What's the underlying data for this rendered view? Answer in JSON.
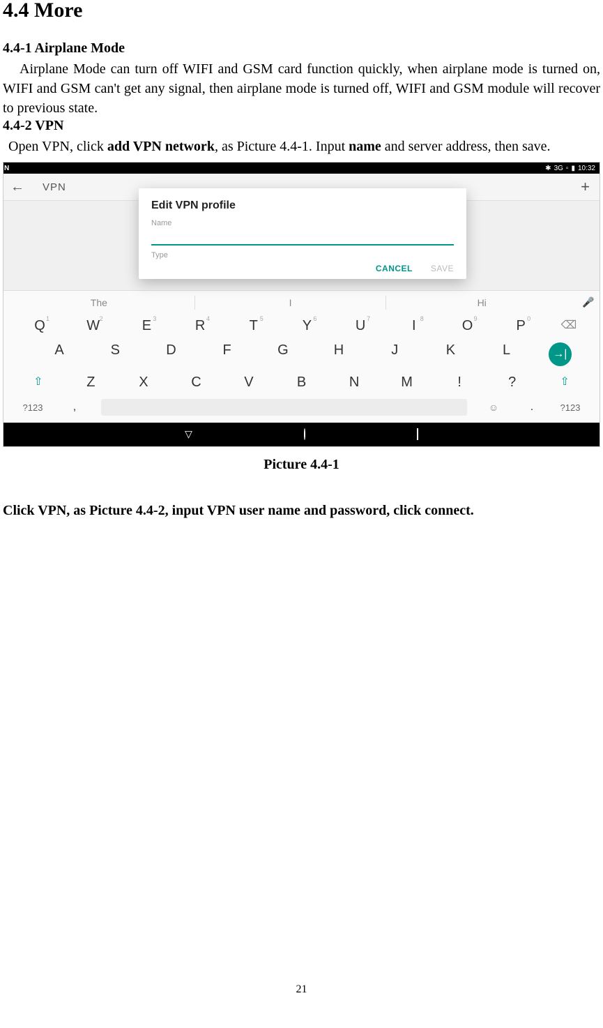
{
  "section": {
    "number_title": "4.4   More"
  },
  "sub1": {
    "title": "4.4-1 Airplane Mode",
    "body": "Airplane Mode can turn off WIFI and GSM card function quickly, when airplane mode is turned on, WIFI and GSM can't get any signal, then airplane mode is turned off, WIFI and GSM module will recover to previous state."
  },
  "sub2": {
    "title": "4.4-2 VPN",
    "body_pre": "Open VPN, click ",
    "bold1": "add VPN network",
    "body_mid": ", as Picture 4.4-1. Input ",
    "bold2": "name",
    "body_post": " and server address, then save."
  },
  "caption1": "Picture 4.4-1",
  "line2": "Click VPN, as Picture 4.4-2, input VPN user name and password, click connect.",
  "page_number": "21",
  "screenshot": {
    "status": {
      "bt": "✱",
      "net": "3G",
      "sig": "▫",
      "batt": "▮",
      "time": "10:32"
    },
    "appbar": {
      "back": "←",
      "title": "VPN",
      "add": "+"
    },
    "dialog": {
      "title": "Edit VPN profile",
      "name_label": "Name",
      "type_label": "Type",
      "cancel": "CANCEL",
      "save": "SAVE"
    },
    "suggestions": {
      "s1": "The",
      "s2": "I",
      "s3": "Hi"
    },
    "keyboard": {
      "row1": [
        {
          "k": "Q",
          "n": "1"
        },
        {
          "k": "W",
          "n": "2"
        },
        {
          "k": "E",
          "n": "3"
        },
        {
          "k": "R",
          "n": "4"
        },
        {
          "k": "T",
          "n": "5"
        },
        {
          "k": "Y",
          "n": "6"
        },
        {
          "k": "U",
          "n": "7"
        },
        {
          "k": "I",
          "n": "8"
        },
        {
          "k": "O",
          "n": "9"
        },
        {
          "k": "P",
          "n": "0"
        }
      ],
      "row2": [
        "A",
        "S",
        "D",
        "F",
        "G",
        "H",
        "J",
        "K",
        "L"
      ],
      "row3_keys": [
        "Z",
        "X",
        "C",
        "V",
        "B",
        "N",
        "M",
        "!",
        "?"
      ],
      "shift": "⇧",
      "go": "→|",
      "sym": "?123",
      "comma": ",",
      "emoji": "☺",
      "dot": ".",
      "backspace": "⌫"
    }
  }
}
